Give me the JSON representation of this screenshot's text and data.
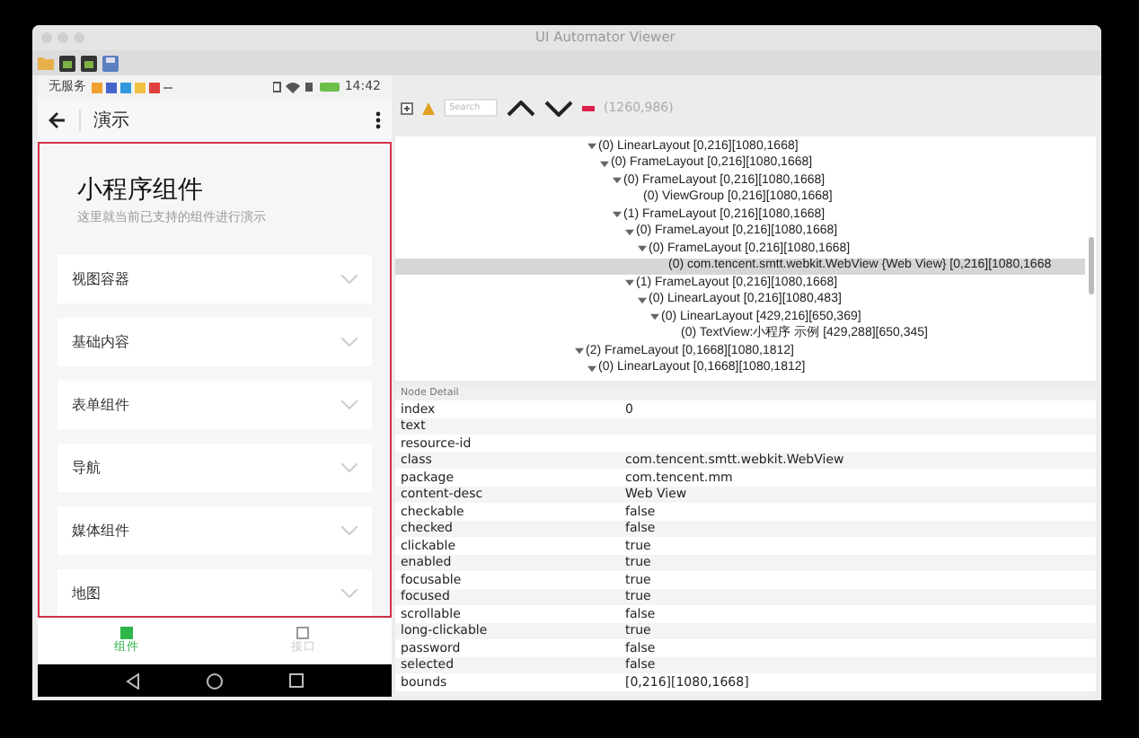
{
  "window": {
    "title": "UI Automator Viewer"
  },
  "phone": {
    "status_bar": {
      "carrier": "无服务",
      "time": "14:42"
    },
    "app_bar": {
      "title": "演示"
    },
    "page": {
      "title": "小程序组件",
      "subtitle": "这里就当前已支持的组件进行演示",
      "items": [
        {
          "label": "视图容器",
          "expanded": false
        },
        {
          "label": "基础内容",
          "expanded": false
        },
        {
          "label": "表单组件",
          "expanded": false
        },
        {
          "label": "导航",
          "expanded": false
        },
        {
          "label": "媒体组件",
          "expanded": false
        },
        {
          "label": "地图",
          "expanded": false
        }
      ]
    },
    "tabs": [
      {
        "label": "组件",
        "selected": true
      },
      {
        "label": "接口",
        "selected": false
      }
    ]
  },
  "toolbar": {
    "search": {
      "placeholder": "Search"
    },
    "coordinates": "(1260,986)"
  },
  "tree": [
    {
      "children": [
        {
          "label": "(0) LinearLayout [0,216][1080,1668]",
          "expanded": true,
          "selected": false,
          "children": [
            {
              "label": "(0) FrameLayout [0,216][1080,1668]",
              "expanded": true,
              "selected": false,
              "children": [
                {
                  "label": "(0) FrameLayout [0,216][1080,1668]",
                  "expanded": true,
                  "selected": false,
                  "children": [
                    {
                      "label": "(0) ViewGroup [0,216][1080,1668]",
                      "selected": false
                    }
                  ]
                },
                {
                  "label": "(1) FrameLayout [0,216][1080,1668]",
                  "expanded": true,
                  "selected": false,
                  "children": [
                    {
                      "label": "(0) FrameLayout [0,216][1080,1668]",
                      "expanded": true,
                      "selected": false,
                      "children": [
                        {
                          "label": "(0) FrameLayout [0,216][1080,1668]",
                          "expanded": true,
                          "selected": false,
                          "children": [
                            {
                              "label": "(0) com.tencent.smtt.webkit.WebView {Web View} [0,216][1080,1668",
                              "selected": true
                            }
                          ]
                        }
                      ]
                    },
                    {
                      "label": "(1) FrameLayout [0,216][1080,1668]",
                      "expanded": true,
                      "selected": false,
                      "children": [
                        {
                          "label": "(0) LinearLayout [0,216][1080,483]",
                          "expanded": true,
                          "selected": false,
                          "children": [
                            {
                              "label": "(0) LinearLayout [429,216][650,369]",
                              "expanded": true,
                              "selected": false,
                              "children": [
                                {
                                  "label": "(0) TextView:小程序 示例 [429,288][650,345]",
                                  "selected": false
                                }
                              ]
                            }
                          ]
                        }
                      ]
                    }
                  ]
                }
              ]
            }
          ]
        }
      ]
    },
    {
      "label": "(2) FrameLayout [0,1668][1080,1812]",
      "expanded": true,
      "selected": false,
      "children": [
        {
          "label": "(0) LinearLayout [0,1668][1080,1812]",
          "expanded": true,
          "selected": false
        }
      ]
    }
  ],
  "node_detail": {
    "title": "Node Detail",
    "rows": [
      {
        "key": "index",
        "value": "0"
      },
      {
        "key": "text"
      },
      {
        "key": "resource-id"
      },
      {
        "key": "class",
        "value": "com.tencent.smtt.webkit.WebView"
      },
      {
        "key": "package",
        "value": "com.tencent.mm"
      },
      {
        "key": "content-desc",
        "value": "Web View"
      },
      {
        "key": "checkable",
        "value": "false"
      },
      {
        "key": "checked",
        "value": "false"
      },
      {
        "key": "clickable",
        "value": "true"
      },
      {
        "key": "enabled",
        "value": "true"
      },
      {
        "key": "focusable",
        "value": "true"
      },
      {
        "key": "focused",
        "value": "true"
      },
      {
        "key": "scrollable",
        "value": "false"
      },
      {
        "key": "long-clickable",
        "value": "true"
      },
      {
        "key": "password",
        "value": "false"
      },
      {
        "key": "selected",
        "value": "false"
      },
      {
        "key": "bounds",
        "value": "[0,216][1080,1668]"
      }
    ]
  }
}
